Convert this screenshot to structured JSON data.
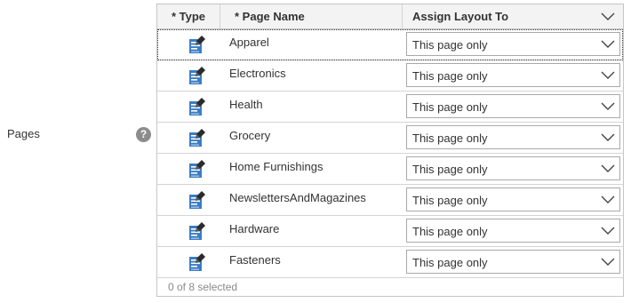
{
  "field": {
    "label": "Pages",
    "help_icon": "?"
  },
  "grid": {
    "columns": {
      "type": "* Type",
      "name": "* Page Name",
      "assign": "Assign Layout To"
    },
    "rows": [
      {
        "name": "Apparel",
        "icon": "page-edit-icon",
        "assign": "This page only"
      },
      {
        "name": "Electronics",
        "icon": "page-edit-icon",
        "assign": "This page only"
      },
      {
        "name": "Health",
        "icon": "page-edit-icon",
        "assign": "This page only"
      },
      {
        "name": "Grocery",
        "icon": "page-edit-icon",
        "assign": "This page only"
      },
      {
        "name": "Home Furnishings",
        "icon": "page-edit-icon",
        "assign": "This page only"
      },
      {
        "name": "NewslettersAndMagazines",
        "icon": "page-edit-icon",
        "assign": "This page only"
      },
      {
        "name": "Hardware",
        "icon": "page-edit-icon",
        "assign": "This page only"
      },
      {
        "name": "Fasteners",
        "icon": "page-edit-icon",
        "assign": "This page only"
      }
    ],
    "footer": "0 of 8 selected"
  },
  "colors": {
    "icon_blue": "#3b7dc4",
    "icon_dark": "#2b2b2b",
    "border": "#c6c6c6",
    "header_bg": "#f3f3f3"
  }
}
